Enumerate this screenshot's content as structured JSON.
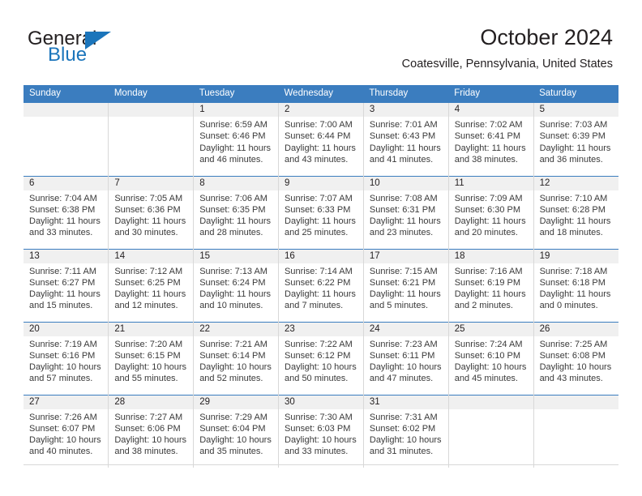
{
  "brand": {
    "name_top": "General",
    "name_bottom": "Blue",
    "accent_color": "#1b75bb",
    "logo_icon": "triangle-flag-icon"
  },
  "header": {
    "title": "October 2024",
    "subtitle": "Coatesville, Pennsylvania, United States"
  },
  "theme": {
    "header_row_bg": "#3b7dbf",
    "daynum_bg": "#f0f0f0",
    "grid_line": "#d8d8d8",
    "text_color": "#231f20"
  },
  "weekdays": [
    "Sunday",
    "Monday",
    "Tuesday",
    "Wednesday",
    "Thursday",
    "Friday",
    "Saturday"
  ],
  "labels": {
    "sunrise_prefix": "Sunrise:",
    "sunset_prefix": "Sunset:",
    "daylight_prefix": "Daylight:"
  },
  "weeks": [
    [
      {
        "day": "",
        "sunrise": "",
        "sunset": "",
        "daylight_line1": "",
        "daylight_line2": "",
        "empty": true
      },
      {
        "day": "",
        "sunrise": "",
        "sunset": "",
        "daylight_line1": "",
        "daylight_line2": "",
        "empty": true
      },
      {
        "day": "1",
        "sunrise": "Sunrise: 6:59 AM",
        "sunset": "Sunset: 6:46 PM",
        "daylight_line1": "Daylight: 11 hours",
        "daylight_line2": "and 46 minutes."
      },
      {
        "day": "2",
        "sunrise": "Sunrise: 7:00 AM",
        "sunset": "Sunset: 6:44 PM",
        "daylight_line1": "Daylight: 11 hours",
        "daylight_line2": "and 43 minutes."
      },
      {
        "day": "3",
        "sunrise": "Sunrise: 7:01 AM",
        "sunset": "Sunset: 6:43 PM",
        "daylight_line1": "Daylight: 11 hours",
        "daylight_line2": "and 41 minutes."
      },
      {
        "day": "4",
        "sunrise": "Sunrise: 7:02 AM",
        "sunset": "Sunset: 6:41 PM",
        "daylight_line1": "Daylight: 11 hours",
        "daylight_line2": "and 38 minutes."
      },
      {
        "day": "5",
        "sunrise": "Sunrise: 7:03 AM",
        "sunset": "Sunset: 6:39 PM",
        "daylight_line1": "Daylight: 11 hours",
        "daylight_line2": "and 36 minutes."
      }
    ],
    [
      {
        "day": "6",
        "sunrise": "Sunrise: 7:04 AM",
        "sunset": "Sunset: 6:38 PM",
        "daylight_line1": "Daylight: 11 hours",
        "daylight_line2": "and 33 minutes."
      },
      {
        "day": "7",
        "sunrise": "Sunrise: 7:05 AM",
        "sunset": "Sunset: 6:36 PM",
        "daylight_line1": "Daylight: 11 hours",
        "daylight_line2": "and 30 minutes."
      },
      {
        "day": "8",
        "sunrise": "Sunrise: 7:06 AM",
        "sunset": "Sunset: 6:35 PM",
        "daylight_line1": "Daylight: 11 hours",
        "daylight_line2": "and 28 minutes."
      },
      {
        "day": "9",
        "sunrise": "Sunrise: 7:07 AM",
        "sunset": "Sunset: 6:33 PM",
        "daylight_line1": "Daylight: 11 hours",
        "daylight_line2": "and 25 minutes."
      },
      {
        "day": "10",
        "sunrise": "Sunrise: 7:08 AM",
        "sunset": "Sunset: 6:31 PM",
        "daylight_line1": "Daylight: 11 hours",
        "daylight_line2": "and 23 minutes."
      },
      {
        "day": "11",
        "sunrise": "Sunrise: 7:09 AM",
        "sunset": "Sunset: 6:30 PM",
        "daylight_line1": "Daylight: 11 hours",
        "daylight_line2": "and 20 minutes."
      },
      {
        "day": "12",
        "sunrise": "Sunrise: 7:10 AM",
        "sunset": "Sunset: 6:28 PM",
        "daylight_line1": "Daylight: 11 hours",
        "daylight_line2": "and 18 minutes."
      }
    ],
    [
      {
        "day": "13",
        "sunrise": "Sunrise: 7:11 AM",
        "sunset": "Sunset: 6:27 PM",
        "daylight_line1": "Daylight: 11 hours",
        "daylight_line2": "and 15 minutes."
      },
      {
        "day": "14",
        "sunrise": "Sunrise: 7:12 AM",
        "sunset": "Sunset: 6:25 PM",
        "daylight_line1": "Daylight: 11 hours",
        "daylight_line2": "and 12 minutes."
      },
      {
        "day": "15",
        "sunrise": "Sunrise: 7:13 AM",
        "sunset": "Sunset: 6:24 PM",
        "daylight_line1": "Daylight: 11 hours",
        "daylight_line2": "and 10 minutes."
      },
      {
        "day": "16",
        "sunrise": "Sunrise: 7:14 AM",
        "sunset": "Sunset: 6:22 PM",
        "daylight_line1": "Daylight: 11 hours",
        "daylight_line2": "and 7 minutes."
      },
      {
        "day": "17",
        "sunrise": "Sunrise: 7:15 AM",
        "sunset": "Sunset: 6:21 PM",
        "daylight_line1": "Daylight: 11 hours",
        "daylight_line2": "and 5 minutes."
      },
      {
        "day": "18",
        "sunrise": "Sunrise: 7:16 AM",
        "sunset": "Sunset: 6:19 PM",
        "daylight_line1": "Daylight: 11 hours",
        "daylight_line2": "and 2 minutes."
      },
      {
        "day": "19",
        "sunrise": "Sunrise: 7:18 AM",
        "sunset": "Sunset: 6:18 PM",
        "daylight_line1": "Daylight: 11 hours",
        "daylight_line2": "and 0 minutes."
      }
    ],
    [
      {
        "day": "20",
        "sunrise": "Sunrise: 7:19 AM",
        "sunset": "Sunset: 6:16 PM",
        "daylight_line1": "Daylight: 10 hours",
        "daylight_line2": "and 57 minutes."
      },
      {
        "day": "21",
        "sunrise": "Sunrise: 7:20 AM",
        "sunset": "Sunset: 6:15 PM",
        "daylight_line1": "Daylight: 10 hours",
        "daylight_line2": "and 55 minutes."
      },
      {
        "day": "22",
        "sunrise": "Sunrise: 7:21 AM",
        "sunset": "Sunset: 6:14 PM",
        "daylight_line1": "Daylight: 10 hours",
        "daylight_line2": "and 52 minutes."
      },
      {
        "day": "23",
        "sunrise": "Sunrise: 7:22 AM",
        "sunset": "Sunset: 6:12 PM",
        "daylight_line1": "Daylight: 10 hours",
        "daylight_line2": "and 50 minutes."
      },
      {
        "day": "24",
        "sunrise": "Sunrise: 7:23 AM",
        "sunset": "Sunset: 6:11 PM",
        "daylight_line1": "Daylight: 10 hours",
        "daylight_line2": "and 47 minutes."
      },
      {
        "day": "25",
        "sunrise": "Sunrise: 7:24 AM",
        "sunset": "Sunset: 6:10 PM",
        "daylight_line1": "Daylight: 10 hours",
        "daylight_line2": "and 45 minutes."
      },
      {
        "day": "26",
        "sunrise": "Sunrise: 7:25 AM",
        "sunset": "Sunset: 6:08 PM",
        "daylight_line1": "Daylight: 10 hours",
        "daylight_line2": "and 43 minutes."
      }
    ],
    [
      {
        "day": "27",
        "sunrise": "Sunrise: 7:26 AM",
        "sunset": "Sunset: 6:07 PM",
        "daylight_line1": "Daylight: 10 hours",
        "daylight_line2": "and 40 minutes."
      },
      {
        "day": "28",
        "sunrise": "Sunrise: 7:27 AM",
        "sunset": "Sunset: 6:06 PM",
        "daylight_line1": "Daylight: 10 hours",
        "daylight_line2": "and 38 minutes."
      },
      {
        "day": "29",
        "sunrise": "Sunrise: 7:29 AM",
        "sunset": "Sunset: 6:04 PM",
        "daylight_line1": "Daylight: 10 hours",
        "daylight_line2": "and 35 minutes."
      },
      {
        "day": "30",
        "sunrise": "Sunrise: 7:30 AM",
        "sunset": "Sunset: 6:03 PM",
        "daylight_line1": "Daylight: 10 hours",
        "daylight_line2": "and 33 minutes."
      },
      {
        "day": "31",
        "sunrise": "Sunrise: 7:31 AM",
        "sunset": "Sunset: 6:02 PM",
        "daylight_line1": "Daylight: 10 hours",
        "daylight_line2": "and 31 minutes."
      },
      {
        "day": "",
        "sunrise": "",
        "sunset": "",
        "daylight_line1": "",
        "daylight_line2": "",
        "empty": true
      },
      {
        "day": "",
        "sunrise": "",
        "sunset": "",
        "daylight_line1": "",
        "daylight_line2": "",
        "empty": true
      }
    ]
  ]
}
